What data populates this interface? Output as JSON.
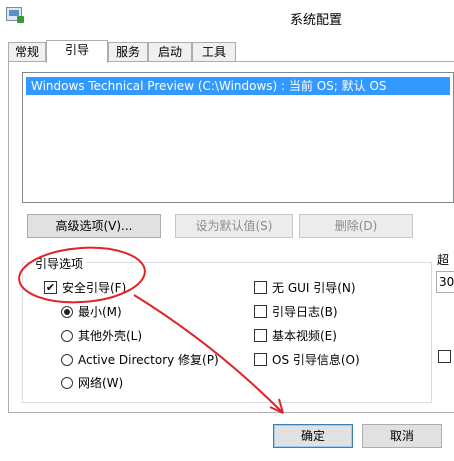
{
  "window": {
    "title": "系统配置",
    "icon": "msconfig-icon"
  },
  "tabs": [
    {
      "label": "常规",
      "active": false
    },
    {
      "label": "引导",
      "active": true
    },
    {
      "label": "服务",
      "active": false
    },
    {
      "label": "启动",
      "active": false
    },
    {
      "label": "工具",
      "active": false
    }
  ],
  "os_list": [
    "Windows Technical Preview (C:\\Windows) : 当前 OS; 默认 OS"
  ],
  "buttons": {
    "advanced": "高级选项(V)...",
    "set_default": "设为默认值(S)",
    "delete": "删除(D)",
    "ok": "确定",
    "cancel": "取消"
  },
  "boot_options": {
    "group_label": "引导选项",
    "safe_boot": {
      "label": "安全引导(F)",
      "checked": true
    },
    "radios": [
      {
        "label": "最小(M)",
        "selected": true
      },
      {
        "label": "其他外壳(L)",
        "selected": false
      },
      {
        "label": "Active Directory 修复(P)",
        "selected": false
      },
      {
        "label": "网络(W)",
        "selected": false
      }
    ],
    "right_checkboxes": [
      {
        "label": "无 GUI 引导(N)",
        "checked": false
      },
      {
        "label": "引导日志(B)",
        "checked": false
      },
      {
        "label": "基本视频(E)",
        "checked": false
      },
      {
        "label": "OS 引导信息(O)",
        "checked": false
      }
    ]
  },
  "timeout": {
    "label": "超",
    "value": "30"
  },
  "annotation_color": "#e0242c"
}
